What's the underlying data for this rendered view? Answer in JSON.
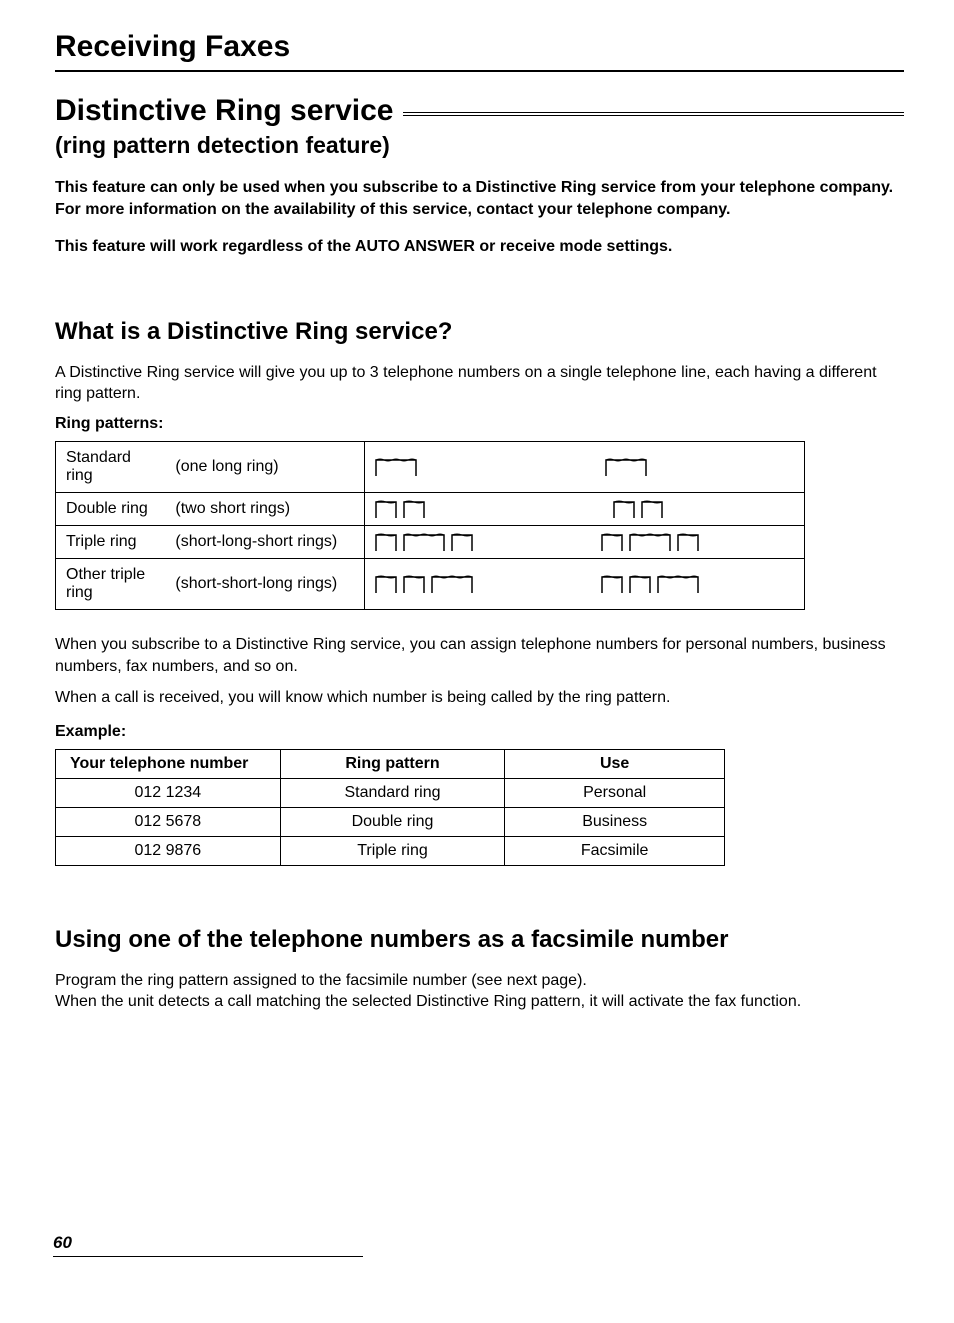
{
  "header": "Receiving Faxes",
  "title": "Distinctive Ring service",
  "subtitle": "(ring pattern detection feature)",
  "intro_para1": "This feature can only be used when you subscribe to a Distinctive Ring service from your telephone company. For more information on the availability of this service, contact your telephone company.",
  "intro_para2": "This feature will work regardless of the AUTO ANSWER or receive mode settings.",
  "section_what": {
    "heading": "What is a Distinctive Ring service?",
    "para": "A Distinctive Ring service will give you up to 3 telephone numbers on a single telephone line, each having a different ring pattern.",
    "ring_patterns_label": "Ring patterns:",
    "patterns": [
      {
        "name": "Standard ring",
        "desc": "(one long ring)"
      },
      {
        "name": "Double ring",
        "desc": "(two short rings)"
      },
      {
        "name": "Triple ring",
        "desc": "(short-long-short rings)"
      },
      {
        "name": "Other triple ring",
        "desc": "(short-short-long rings)"
      }
    ],
    "after_para1": "When you subscribe to a Distinctive Ring service, you can assign telephone numbers for personal numbers, business numbers, fax numbers, and so on.",
    "after_para2": "When a call is received, you will know which number is being called by the ring pattern.",
    "example_label": "Example:",
    "example_headers": [
      "Your telephone number",
      "Ring pattern",
      "Use"
    ],
    "example_rows": [
      {
        "number": "012 1234",
        "pattern": "Standard ring",
        "use": "Personal"
      },
      {
        "number": "012 5678",
        "pattern": "Double ring",
        "use": "Business"
      },
      {
        "number": "012 9876",
        "pattern": "Triple ring",
        "use": "Facsimile"
      }
    ]
  },
  "section_using": {
    "heading": "Using one of the telephone numbers as a facsimile number",
    "para1": "Program the ring pattern assigned to the facsimile number (see next page).",
    "para2": "When the unit detects a call matching the selected Distinctive Ring pattern, it will activate the fax function."
  },
  "page_number": "60"
}
